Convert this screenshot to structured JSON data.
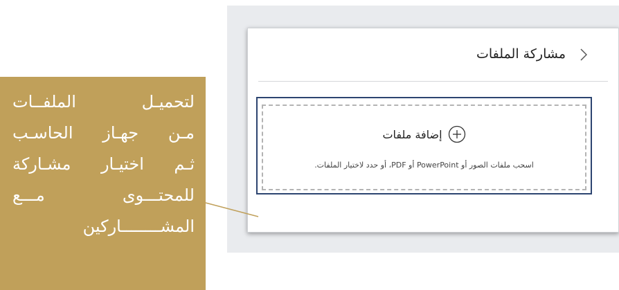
{
  "panel": {
    "title": "مشاركة الملفات",
    "back_icon": "chevron-right-icon"
  },
  "upload": {
    "add_label": "إضافة ملفات",
    "add_icon": "plus-circle-icon",
    "hint": "اسحب ملفات الصور أو PowerPoint أو PDF، أو حدد لاختيار الملفات."
  },
  "callout": {
    "lines": [
      "لتحميـل الملفــات",
      "مـن جهـاز الحاسـب",
      "ثـم اختيـار مشـاركة",
      "للمحتـــوى مـــع",
      "المشــــــــاركين"
    ]
  },
  "colors": {
    "callout_bg": "#c0a05a",
    "frame_border": "#2c4470",
    "backdrop": "#e9ebee"
  }
}
